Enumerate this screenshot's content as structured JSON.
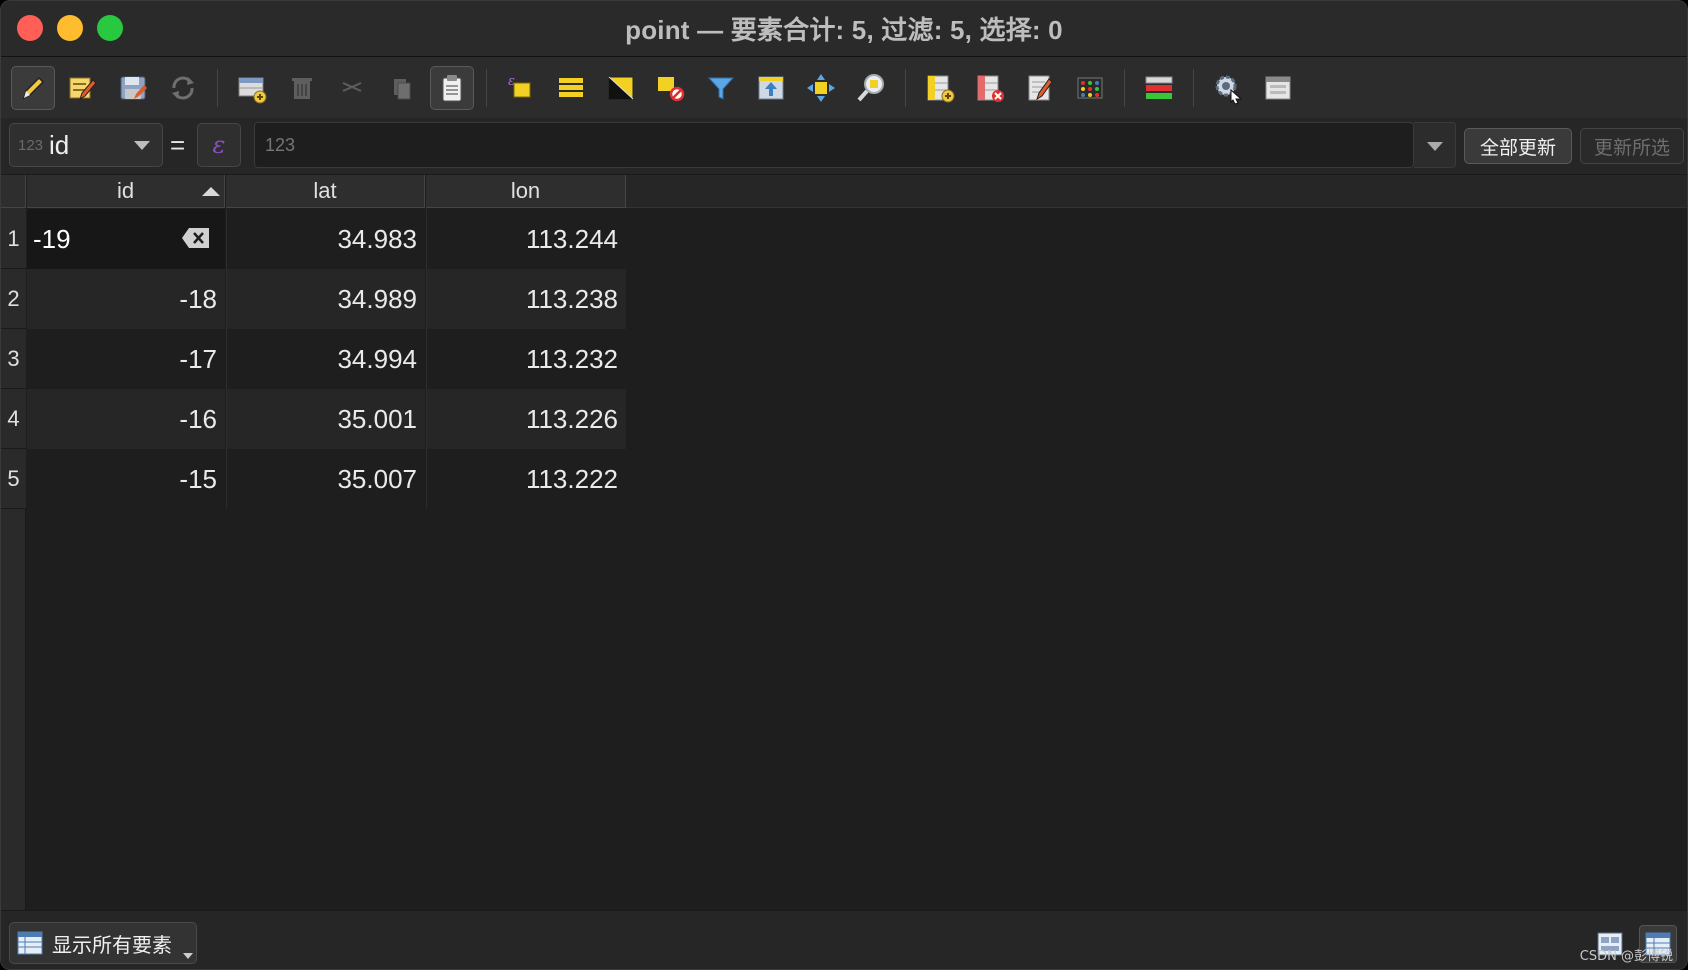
{
  "window": {
    "title": "point — 要素合计: 5, 过滤: 5, 选择: 0"
  },
  "toolbar": {
    "buttons": [
      "toggle-editing",
      "multi-edit",
      "save-edits",
      "reload-table",
      "add-feature",
      "delete-selected",
      "cut-selected",
      "copy-selected",
      "paste-features",
      "select-by-expression",
      "select-all",
      "invert-selection",
      "deselect-all",
      "filter-select",
      "move-selection-top",
      "pan-to-selected",
      "zoom-to-selected",
      "new-field",
      "delete-field",
      "open-field-calculator",
      "conditional-formatting",
      "dock-table",
      "actions",
      "show-form"
    ]
  },
  "filter": {
    "field_type": "123",
    "field_name": "id",
    "operator": "=",
    "expression_symbol": "ε",
    "value_placeholder": "123",
    "update_all_label": "全部更新",
    "update_selected_label": "更新所选"
  },
  "table": {
    "columns": [
      "id",
      "lat",
      "lon"
    ],
    "sort_column": "id",
    "sort_order": "ascending",
    "rows": [
      {
        "num": "1",
        "id": "-19",
        "lat": "34.983",
        "lon": "113.244",
        "editing": true
      },
      {
        "num": "2",
        "id": "-18",
        "lat": "34.989",
        "lon": "113.238"
      },
      {
        "num": "3",
        "id": "-17",
        "lat": "34.994",
        "lon": "113.232"
      },
      {
        "num": "4",
        "id": "-16",
        "lat": "35.001",
        "lon": "113.226"
      },
      {
        "num": "5",
        "id": "-15",
        "lat": "35.007",
        "lon": "113.222"
      }
    ]
  },
  "bottom": {
    "show_all_label": "显示所有要素",
    "watermark": "CSDN @彭博锐"
  }
}
